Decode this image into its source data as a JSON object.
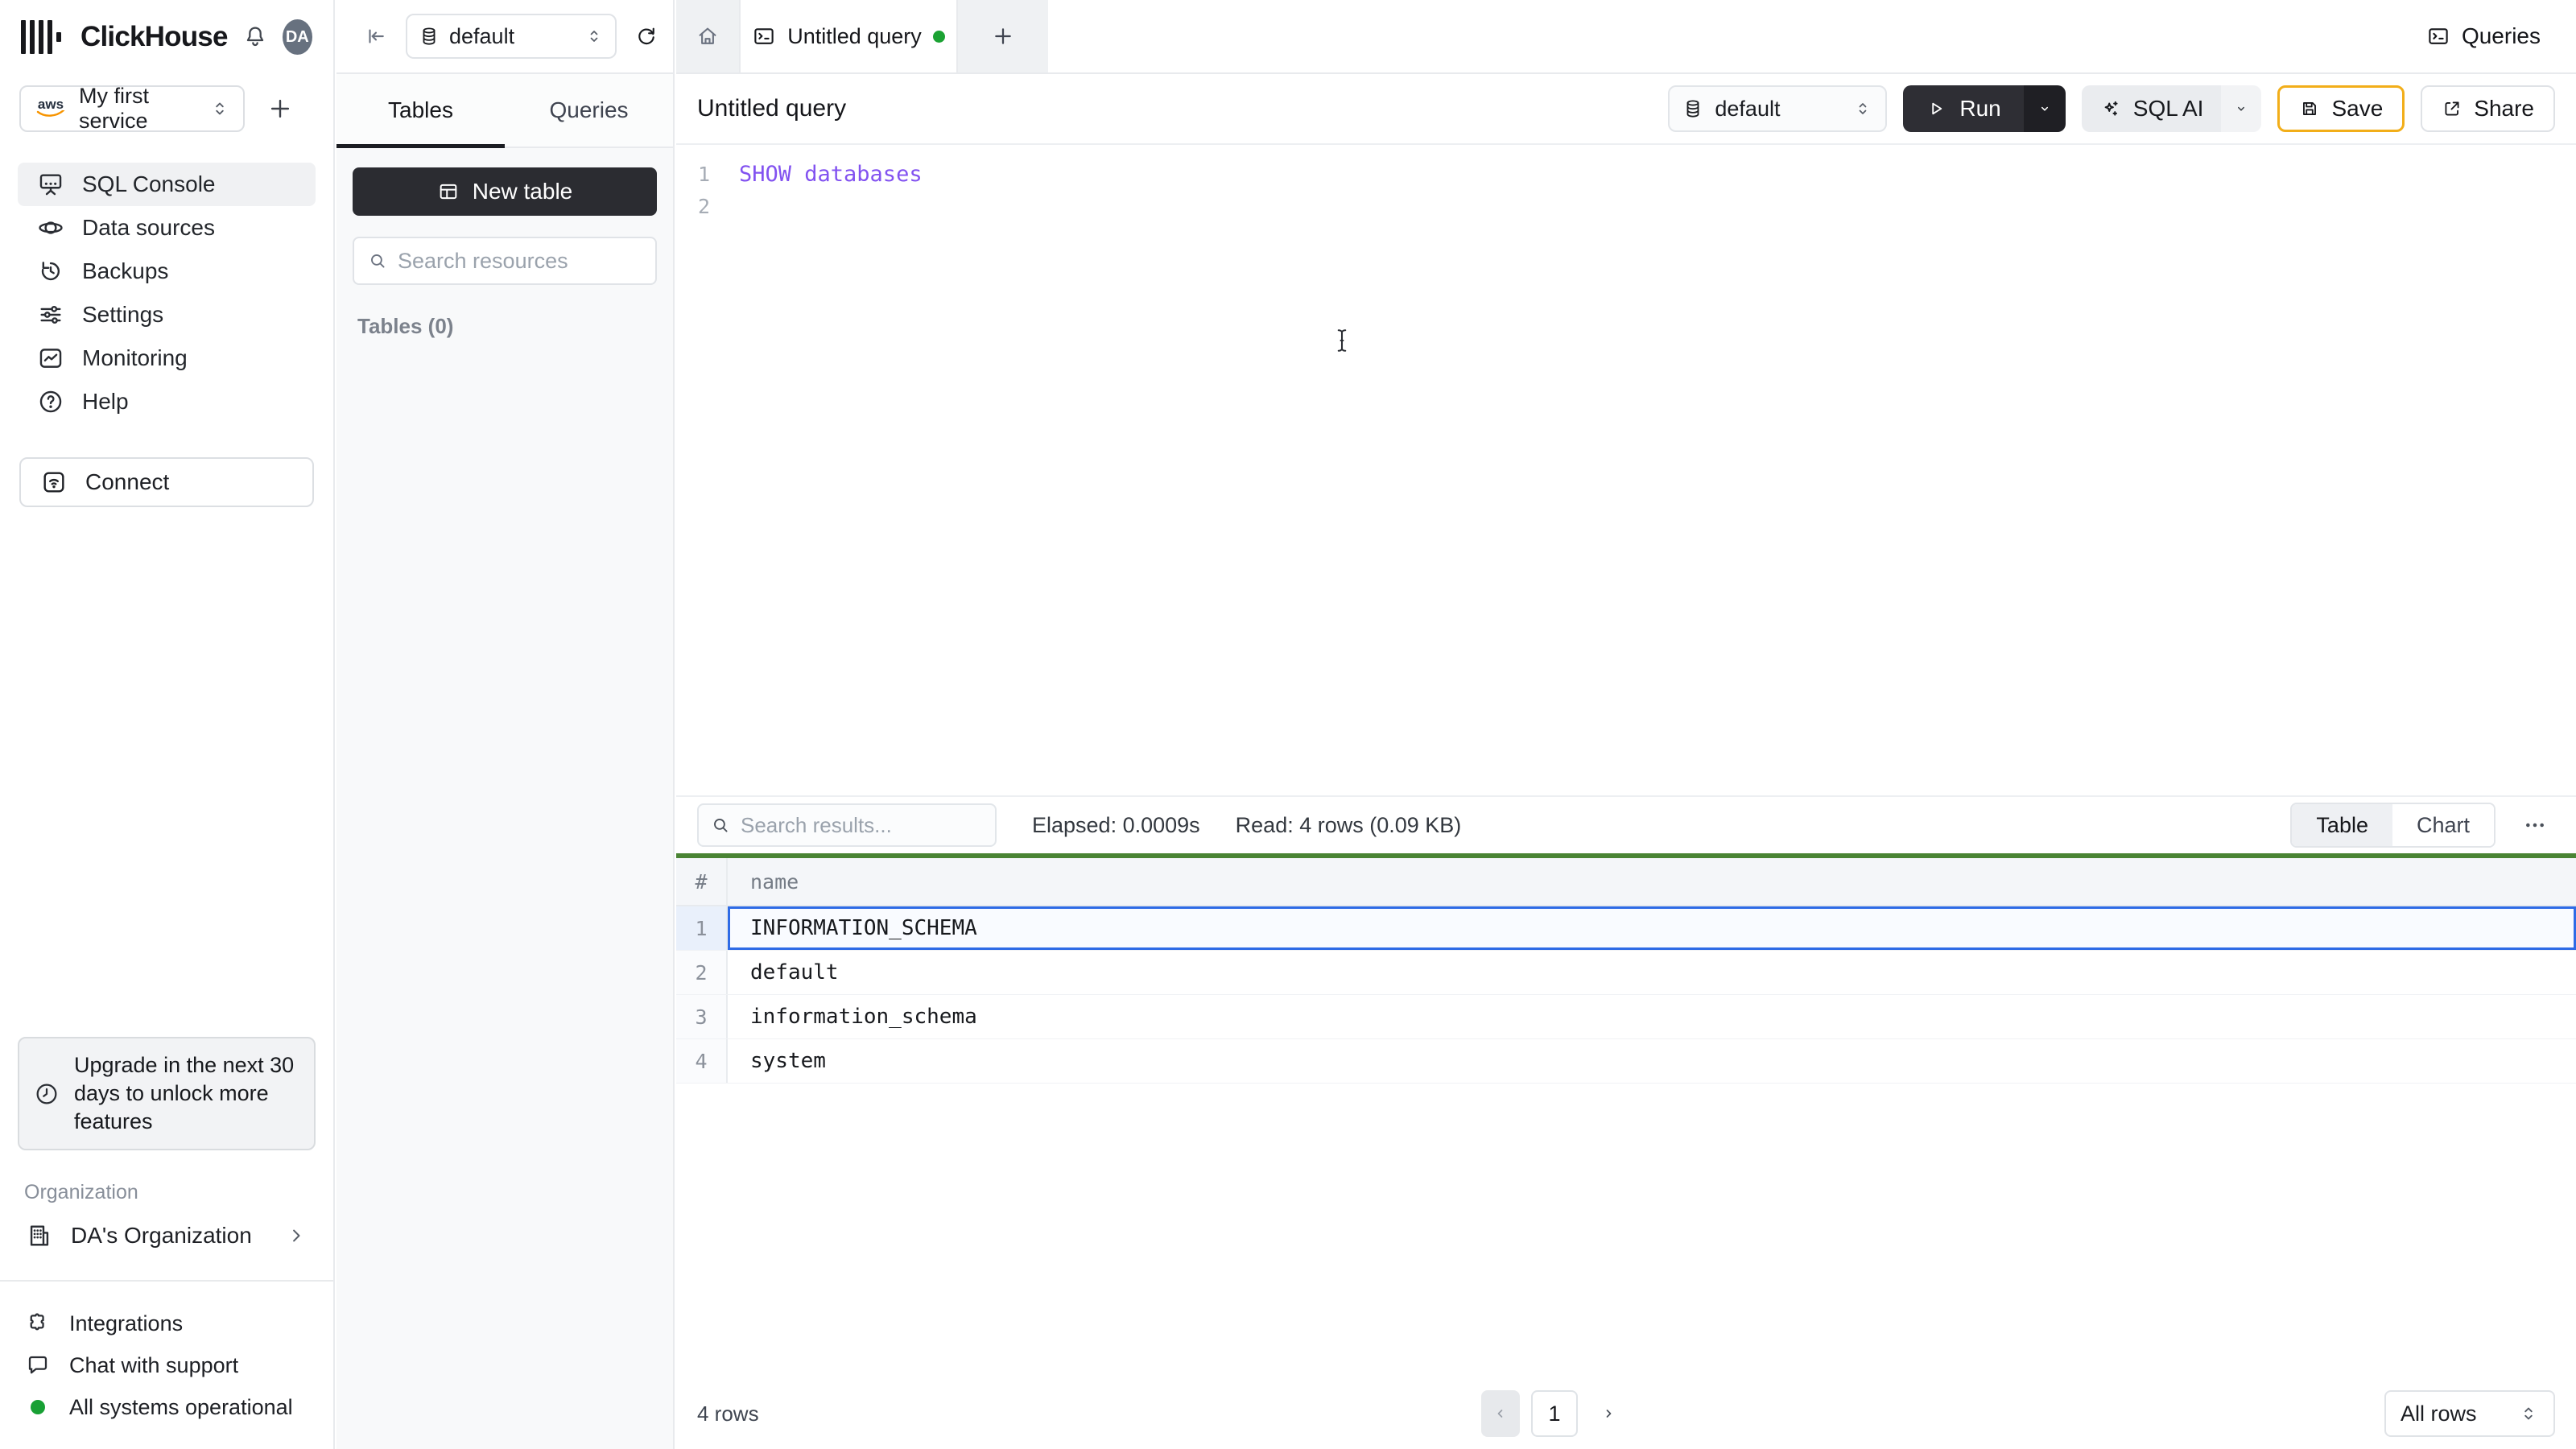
{
  "header": {
    "brand": "ClickHouse",
    "avatar": "DA"
  },
  "sidebar": {
    "service": "My first service",
    "nav": [
      {
        "label": "SQL Console"
      },
      {
        "label": "Data sources"
      },
      {
        "label": "Backups"
      },
      {
        "label": "Settings"
      },
      {
        "label": "Monitoring"
      },
      {
        "label": "Help"
      }
    ],
    "connect": "Connect",
    "upgrade": "Upgrade in the next 30 days to unlock more features",
    "org_section": "Organization",
    "org_name": "DA's Organization",
    "links": [
      {
        "label": "Integrations"
      },
      {
        "label": "Chat with support"
      }
    ],
    "status": "All systems operational"
  },
  "topbar": {
    "database": "default"
  },
  "resources": {
    "tabs": [
      {
        "label": "Tables"
      },
      {
        "label": "Queries"
      }
    ],
    "new_table": "New table",
    "search_placeholder": "Search resources",
    "section_label": "Tables (0)"
  },
  "tabstrip": {
    "active_tab": "Untitled query",
    "queries_button": "Queries"
  },
  "toolbar": {
    "title": "Untitled query",
    "database": "default",
    "run": "Run",
    "sql_ai": "SQL AI",
    "save": "Save",
    "share": "Share"
  },
  "editor": {
    "lines": [
      {
        "num": "1",
        "code": "SHOW databases"
      },
      {
        "num": "2",
        "code": ""
      }
    ]
  },
  "results": {
    "search_placeholder": "Search results...",
    "elapsed": "Elapsed: 0.0009s",
    "read": "Read: 4 rows (0.09 KB)",
    "views": [
      {
        "label": "Table"
      },
      {
        "label": "Chart"
      }
    ],
    "columns": {
      "index": "#",
      "name": "name"
    },
    "rows": [
      {
        "n": "1",
        "name": "INFORMATION_SCHEMA"
      },
      {
        "n": "2",
        "name": "default"
      },
      {
        "n": "3",
        "name": "information_schema"
      },
      {
        "n": "4",
        "name": "system"
      }
    ],
    "footer": {
      "count": "4 rows",
      "page": "1",
      "page_size": "All rows"
    }
  },
  "colors": {
    "save_accent": "#f2ae19",
    "run_button": "#2e2e34",
    "selection_blue": "#2e6be6",
    "results_success_green": "#4a8434",
    "sql_keyword_purple": "#8252f0",
    "status_green": "#18a034"
  }
}
